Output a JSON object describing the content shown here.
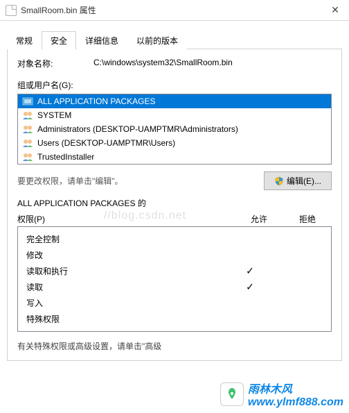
{
  "window": {
    "title": "SmallRoom.bin 属性"
  },
  "tabs": {
    "general": "常规",
    "security": "安全",
    "details": "详细信息",
    "previous": "以前的版本"
  },
  "object": {
    "label": "对象名称:",
    "value": "C:\\windows\\system32\\SmallRoom.bin"
  },
  "groups": {
    "label": "组或用户名(G):",
    "items": [
      {
        "name": "ALL APPLICATION PACKAGES",
        "selected": true,
        "icon": "pkg"
      },
      {
        "name": "SYSTEM",
        "selected": false,
        "icon": "group"
      },
      {
        "name": "Administrators (DESKTOP-UAMPTMR\\Administrators)",
        "selected": false,
        "icon": "group"
      },
      {
        "name": "Users (DESKTOP-UAMPTMR\\Users)",
        "selected": false,
        "icon": "group"
      },
      {
        "name": "TrustedInstaller",
        "selected": false,
        "icon": "group"
      }
    ]
  },
  "edit": {
    "hint": "要更改权限，请单击\"编辑\"。",
    "button": "编辑(E)..."
  },
  "perms": {
    "header_for": "ALL APPLICATION PACKAGES 的",
    "header_perm": "权限(P)",
    "allow": "允许",
    "deny": "拒绝",
    "rows": [
      {
        "name": "完全控制",
        "allow": false,
        "deny": false
      },
      {
        "name": "修改",
        "allow": false,
        "deny": false
      },
      {
        "name": "读取和执行",
        "allow": true,
        "deny": false
      },
      {
        "name": "读取",
        "allow": true,
        "deny": false
      },
      {
        "name": "写入",
        "allow": false,
        "deny": false
      },
      {
        "name": "特殊权限",
        "allow": false,
        "deny": false
      }
    ]
  },
  "advanced_hint": "有关特殊权限或高级设置，请单击\"高级",
  "bg_watermark": "//blog.csdn.net",
  "watermark": {
    "text": "雨林木风",
    "url": "www.ylmf888.com"
  }
}
